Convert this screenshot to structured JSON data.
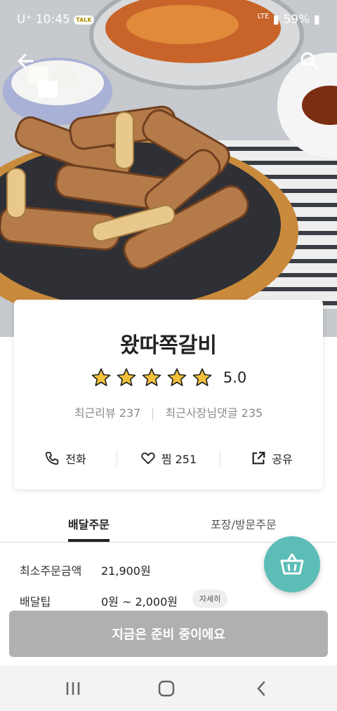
{
  "status_bar": {
    "carrier": "U⁺",
    "time": "10:45",
    "talk": "TALK",
    "network": "LTE",
    "battery": "59%"
  },
  "store": {
    "name": "왔따쪽갈비",
    "rating": "5.0",
    "rating_value": 5,
    "recent_reviews": "최근리뷰 237",
    "owner_comments": "최근사장님댓글 235"
  },
  "actions": {
    "call": "전화",
    "favorite": "찜 251",
    "share": "공유"
  },
  "tabs": {
    "delivery": "배달주문",
    "pickup": "포장/방문주문"
  },
  "info": {
    "min_order_label": "최소주문금액",
    "min_order_value": "21,900원",
    "delivery_tip_label": "배달팁",
    "delivery_tip_value": "0원 ~ 2,000원",
    "detail_label": "자세히"
  },
  "order_button": "지금은 준비 중이에요",
  "colors": {
    "fab": "#5cbdb6",
    "star": "#f6c13a",
    "disabled": "#b0b0b0"
  },
  "icons": [
    "back-arrow-icon",
    "search-icon",
    "star-icon",
    "phone-icon",
    "heart-icon",
    "share-icon",
    "basket-icon",
    "recent-apps-icon",
    "home-icon",
    "back-icon"
  ]
}
